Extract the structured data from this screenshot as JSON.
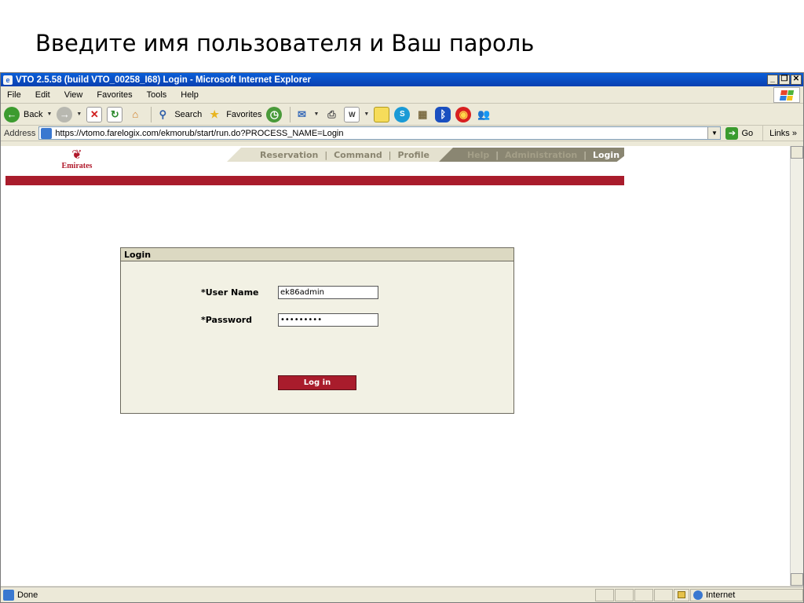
{
  "slide": {
    "title": "Введите имя пользователя и Ваш пароль"
  },
  "window": {
    "title": "VTO 2.5.58 (build VTO_00258_I68) Login - Microsoft Internet Explorer",
    "controls": [
      "_",
      "❐",
      "✕"
    ]
  },
  "menu": [
    "File",
    "Edit",
    "View",
    "Favorites",
    "Tools",
    "Help"
  ],
  "toolbar": {
    "back_label": "Back",
    "search_label": "Search",
    "favorites_label": "Favorites"
  },
  "address": {
    "label": "Address",
    "url": "https://vtomo.farelogix.com/ekmorub/start/run.do?PROCESS_NAME=Login",
    "go_label": "Go",
    "links_label": "Links"
  },
  "site": {
    "brand": "Emirates",
    "nav": [
      "Reservation",
      "Command",
      "Profile",
      "Help",
      "Administration",
      "Login"
    ]
  },
  "login": {
    "panel_title": "Login",
    "username_label": "*User Name",
    "username_value": "ek86admin",
    "password_label": "*Password",
    "password_value": "•••••••••",
    "button_label": "Log in"
  },
  "status": {
    "text": "Done",
    "zone": "Internet"
  },
  "colors": {
    "brand_red": "#a91c2c",
    "panel_bg": "#f2f1e4",
    "titlebar_blue": "#0a5fd8"
  }
}
